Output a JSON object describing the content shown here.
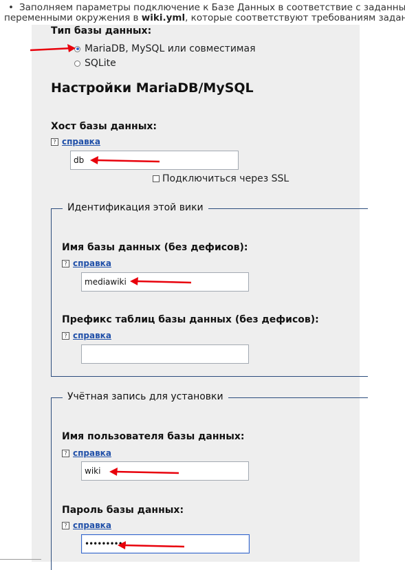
{
  "intro": {
    "bullet": "•",
    "line1": "Заполняем параметры подключение к Базе Данных в соответствие с заданными",
    "line2_prefix": "переменными окружения в ",
    "line2_file": "wiki.yml",
    "line2_suffix": ", которые соответствуют требованиям задания:"
  },
  "db_type": {
    "label": "Тип базы данных:",
    "options": [
      {
        "label": "MariaDB, MySQL или совместимая",
        "selected": true
      },
      {
        "label": "SQLite",
        "selected": false
      }
    ]
  },
  "settings_heading": "Настройки MariaDB/MySQL",
  "host": {
    "label": "Хост базы данных:",
    "help": "справка",
    "value": "db"
  },
  "ssl": {
    "label": "Подключиться через SSL",
    "checked": false
  },
  "wiki_id": {
    "legend": "Идентификация этой вики",
    "db_name": {
      "label": "Имя базы данных (без дефисов):",
      "help": "справка",
      "value": "mediawiki"
    },
    "prefix": {
      "label": "Префикс таблиц базы данных (без дефисов):",
      "help": "справка",
      "value": ""
    }
  },
  "install_account": {
    "legend": "Учётная запись для установки",
    "user": {
      "label": "Имя пользователя базы данных:",
      "help": "справка",
      "value": "wiki"
    },
    "password": {
      "label": "Пароль базы данных:",
      "help": "справка",
      "value": "••••••••••"
    }
  },
  "colors": {
    "arrow": "#e8000b",
    "link": "#1f4fa8",
    "panel": "#eeeeee",
    "fieldset_border": "#2a4b7c",
    "focus": "#3366cc"
  },
  "icons": {
    "help": "help-icon",
    "arrow": "red-arrow-annotation"
  }
}
